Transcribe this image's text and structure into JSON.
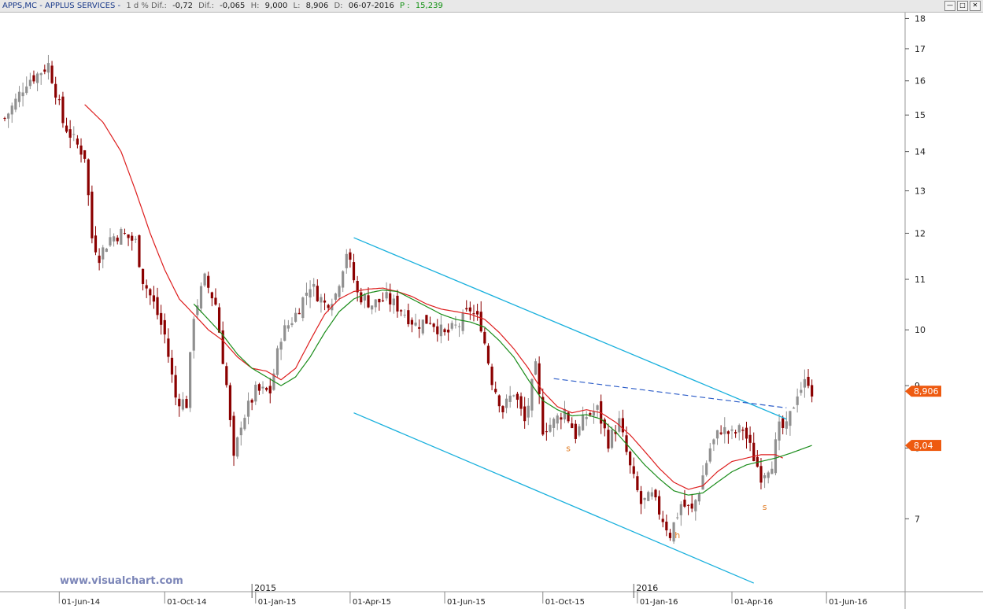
{
  "titlebar": {
    "symbol": "APPS,MC - APPLUS SERVICES -",
    "timeframe": "1 d % Dif.:",
    "pct_change": "-0,72",
    "dif_label": "Dif.:",
    "dif_value": "-0,065",
    "high_label": "H:",
    "high_value": "9,000",
    "low_label": "L:",
    "low_value": "8,906",
    "date_label": "D:",
    "date_value": "06-07-2016",
    "p_label": "P :",
    "p_value": "15,239",
    "window_buttons": [
      "minimize-icon",
      "restore-icon",
      "close-icon"
    ]
  },
  "watermark": "www.visualchart.com",
  "colors": {
    "candle_up": "#909090",
    "candle_down": "#8b0000",
    "ma_red": "#dd1e1e",
    "ma_green": "#1a8c1a",
    "channel": "#19b0dd",
    "dashed_trend": "#2b5cc8",
    "tag_orange": "#ee5a10",
    "annotation": "#e07a20"
  },
  "chart_data": {
    "type": "candlestick",
    "y_scale": "log",
    "y_ticks": [
      7,
      8,
      9,
      10,
      11,
      12,
      13,
      14,
      15,
      16,
      17,
      18
    ],
    "ylim": [
      6.1,
      18.2
    ],
    "x_ticks": [
      "01-Jun-14",
      "01-Oct-14",
      "01-Jan-15",
      "01-Apr-15",
      "01-Jun-15",
      "01-Oct-15",
      "01-Jan-16",
      "01-Apr-16",
      "01-Jun-16"
    ],
    "year_markers": [
      "2015",
      "2016"
    ],
    "price_tags": [
      {
        "label": "8,906",
        "value": 8.906
      },
      {
        "label": "8,04",
        "value": 8.04
      }
    ],
    "annotations": [
      {
        "text": "s",
        "x_index": 155,
        "price": 7.95
      },
      {
        "text": "h",
        "x_index": 185,
        "price": 6.75
      },
      {
        "text": "s",
        "x_index": 209,
        "price": 7.12
      }
    ],
    "close_waypoints": [
      [
        0,
        14.9
      ],
      [
        3,
        15.4
      ],
      [
        6,
        16.0
      ],
      [
        9,
        16.2
      ],
      [
        12,
        16.5
      ],
      [
        14,
        15.7
      ],
      [
        16,
        14.8
      ],
      [
        19,
        14.3
      ],
      [
        22,
        13.9
      ],
      [
        24,
        11.9
      ],
      [
        26,
        11.5
      ],
      [
        29,
        11.9
      ],
      [
        32,
        12.0
      ],
      [
        36,
        11.8
      ],
      [
        38,
        11.0
      ],
      [
        41,
        10.5
      ],
      [
        44,
        9.9
      ],
      [
        47,
        8.8
      ],
      [
        50,
        8.7
      ],
      [
        52,
        10.3
      ],
      [
        55,
        11.0
      ],
      [
        58,
        10.5
      ],
      [
        61,
        9.0
      ],
      [
        63,
        7.8
      ],
      [
        65,
        8.4
      ],
      [
        69,
        8.9
      ],
      [
        73,
        8.9
      ],
      [
        76,
        9.9
      ],
      [
        80,
        10.3
      ],
      [
        84,
        10.9
      ],
      [
        88,
        10.5
      ],
      [
        91,
        10.7
      ],
      [
        94,
        11.6
      ],
      [
        97,
        10.7
      ],
      [
        101,
        10.5
      ],
      [
        105,
        10.6
      ],
      [
        109,
        10.4
      ],
      [
        113,
        10.1
      ],
      [
        117,
        10.2
      ],
      [
        121,
        9.9
      ],
      [
        125,
        10.1
      ],
      [
        128,
        10.4
      ],
      [
        131,
        10.1
      ],
      [
        134,
        9.1
      ],
      [
        137,
        8.6
      ],
      [
        140,
        8.9
      ],
      [
        143,
        8.4
      ],
      [
        146,
        9.3
      ],
      [
        148,
        8.3
      ],
      [
        151,
        8.4
      ],
      [
        154,
        8.6
      ],
      [
        157,
        8.2
      ],
      [
        160,
        8.5
      ],
      [
        163,
        8.6
      ],
      [
        166,
        8.1
      ],
      [
        169,
        8.4
      ],
      [
        172,
        7.7
      ],
      [
        175,
        7.2
      ],
      [
        178,
        7.3
      ],
      [
        181,
        7.0
      ],
      [
        183,
        6.8
      ],
      [
        186,
        7.2
      ],
      [
        189,
        7.1
      ],
      [
        191,
        7.4
      ],
      [
        194,
        8.0
      ],
      [
        197,
        8.3
      ],
      [
        200,
        8.2
      ],
      [
        203,
        8.3
      ],
      [
        205,
        8.0
      ],
      [
        208,
        7.6
      ],
      [
        211,
        7.8
      ],
      [
        213,
        8.3
      ],
      [
        215,
        8.3
      ],
      [
        218,
        8.9
      ],
      [
        221,
        9.1
      ],
      [
        222,
        8.906
      ]
    ],
    "ma_red_waypoints": [
      [
        22,
        15.3
      ],
      [
        27,
        14.8
      ],
      [
        32,
        14.0
      ],
      [
        36,
        13.0
      ],
      [
        40,
        12.0
      ],
      [
        44,
        11.2
      ],
      [
        48,
        10.6
      ],
      [
        52,
        10.3
      ],
      [
        56,
        10.0
      ],
      [
        60,
        9.8
      ],
      [
        64,
        9.5
      ],
      [
        68,
        9.3
      ],
      [
        72,
        9.25
      ],
      [
        76,
        9.1
      ],
      [
        80,
        9.3
      ],
      [
        84,
        9.8
      ],
      [
        88,
        10.3
      ],
      [
        92,
        10.6
      ],
      [
        96,
        10.75
      ],
      [
        100,
        10.8
      ],
      [
        104,
        10.82
      ],
      [
        108,
        10.75
      ],
      [
        112,
        10.65
      ],
      [
        116,
        10.5
      ],
      [
        120,
        10.4
      ],
      [
        124,
        10.35
      ],
      [
        128,
        10.3
      ],
      [
        132,
        10.2
      ],
      [
        136,
        9.95
      ],
      [
        140,
        9.65
      ],
      [
        144,
        9.3
      ],
      [
        148,
        8.9
      ],
      [
        152,
        8.65
      ],
      [
        156,
        8.55
      ],
      [
        160,
        8.6
      ],
      [
        164,
        8.55
      ],
      [
        168,
        8.4
      ],
      [
        172,
        8.2
      ],
      [
        176,
        7.95
      ],
      [
        180,
        7.7
      ],
      [
        184,
        7.5
      ],
      [
        188,
        7.4
      ],
      [
        192,
        7.45
      ],
      [
        196,
        7.65
      ],
      [
        200,
        7.8
      ],
      [
        204,
        7.85
      ],
      [
        208,
        7.9
      ],
      [
        212,
        7.9
      ],
      [
        214,
        7.85
      ]
    ],
    "ma_green_waypoints": [
      [
        52,
        10.5
      ],
      [
        56,
        10.2
      ],
      [
        60,
        9.9
      ],
      [
        64,
        9.55
      ],
      [
        68,
        9.3
      ],
      [
        72,
        9.15
      ],
      [
        76,
        9.0
      ],
      [
        80,
        9.15
      ],
      [
        84,
        9.5
      ],
      [
        88,
        9.95
      ],
      [
        92,
        10.35
      ],
      [
        96,
        10.6
      ],
      [
        100,
        10.72
      ],
      [
        104,
        10.78
      ],
      [
        108,
        10.75
      ],
      [
        112,
        10.6
      ],
      [
        116,
        10.45
      ],
      [
        120,
        10.3
      ],
      [
        124,
        10.2
      ],
      [
        128,
        10.15
      ],
      [
        132,
        10.05
      ],
      [
        136,
        9.8
      ],
      [
        140,
        9.5
      ],
      [
        144,
        9.1
      ],
      [
        148,
        8.75
      ],
      [
        152,
        8.6
      ],
      [
        156,
        8.5
      ],
      [
        160,
        8.52
      ],
      [
        164,
        8.45
      ],
      [
        168,
        8.25
      ],
      [
        172,
        8.0
      ],
      [
        176,
        7.75
      ],
      [
        180,
        7.55
      ],
      [
        184,
        7.38
      ],
      [
        188,
        7.32
      ],
      [
        192,
        7.35
      ],
      [
        196,
        7.5
      ],
      [
        200,
        7.65
      ],
      [
        204,
        7.75
      ],
      [
        208,
        7.8
      ],
      [
        212,
        7.85
      ],
      [
        216,
        7.92
      ],
      [
        220,
        8.0
      ],
      [
        222,
        8.04
      ]
    ],
    "channel_upper": [
      [
        96,
        11.9
      ],
      [
        215,
        8.45
      ]
    ],
    "channel_lower": [
      [
        96,
        8.55
      ],
      [
        206,
        6.2
      ]
    ],
    "dashed_trendline": [
      [
        151,
        9.12
      ],
      [
        215,
        8.63
      ]
    ]
  }
}
